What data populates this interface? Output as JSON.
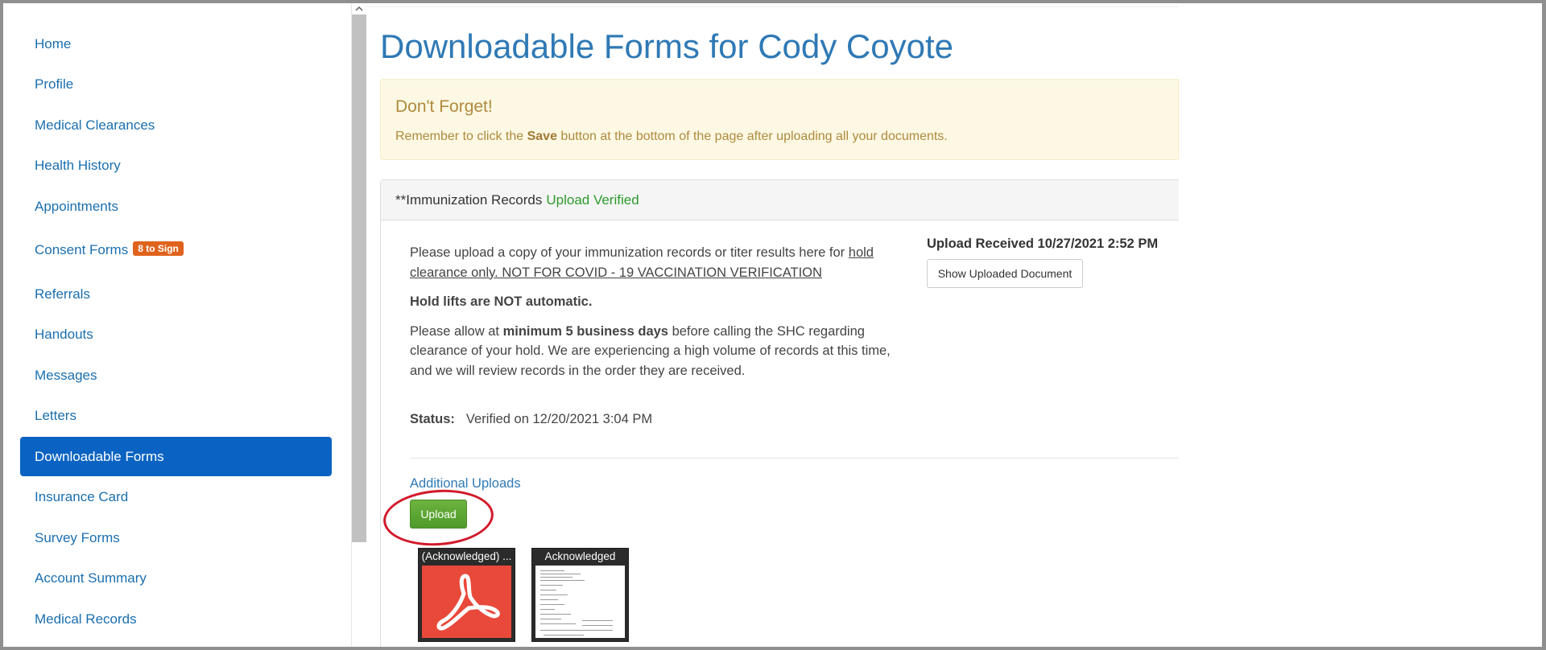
{
  "sidebar": {
    "items": [
      {
        "label": "Home"
      },
      {
        "label": "Profile"
      },
      {
        "label": "Medical Clearances"
      },
      {
        "label": "Health History"
      },
      {
        "label": "Appointments"
      },
      {
        "label": "Consent Forms",
        "badge": "8 to Sign"
      },
      {
        "label": "Referrals"
      },
      {
        "label": "Handouts"
      },
      {
        "label": "Messages"
      },
      {
        "label": "Letters"
      },
      {
        "label": "Downloadable Forms",
        "active": true
      },
      {
        "label": "Insurance Card"
      },
      {
        "label": "Survey Forms"
      },
      {
        "label": "Account Summary"
      },
      {
        "label": "Medical Records"
      }
    ]
  },
  "main": {
    "title": "Downloadable Forms for Cody Coyote",
    "alert": {
      "title": "Don't Forget!",
      "text_before": "Remember to click the ",
      "text_bold": "Save",
      "text_after": " button at the bottom of the page after uploading all your documents."
    },
    "panel": {
      "heading": "**Immunization Records",
      "heading_status": "Upload Verified",
      "para1_plain": "Please upload a copy of your immunization records or titer results here for ",
      "para1_underlined": "hold clearance only. NOT FOR COVID - 19 VACCINATION VERIFICATION",
      "hold_note": "Hold lifts are NOT automatic.",
      "para2_before": "Please allow at ",
      "para2_bold": "minimum 5 business days",
      "para2_after": " before calling the SHC regarding clearance of your hold. We are experiencing a high volume of records at this time, and we will review records in the order they are received.",
      "status_label": "Status:",
      "status_value": "Verified on 12/20/2021 3:04 PM",
      "upload_received": "Upload Received 10/27/2021 2:52 PM",
      "show_uploaded_button": "Show Uploaded Document",
      "additional_uploads": "Additional Uploads",
      "upload_button": "Upload",
      "thumbnails": [
        {
          "label": "(Acknowledged) ...",
          "icon": "pdf-icon"
        },
        {
          "label": "Acknowledged",
          "icon": "document-preview"
        }
      ]
    }
  },
  "colors": {
    "link": "#1a6fb0",
    "active_nav": "#0a63c2",
    "badge": "#e0631d",
    "verified": "#2d9a2d",
    "upload_button": "#5ca735",
    "annotation": "#d11a2a"
  }
}
